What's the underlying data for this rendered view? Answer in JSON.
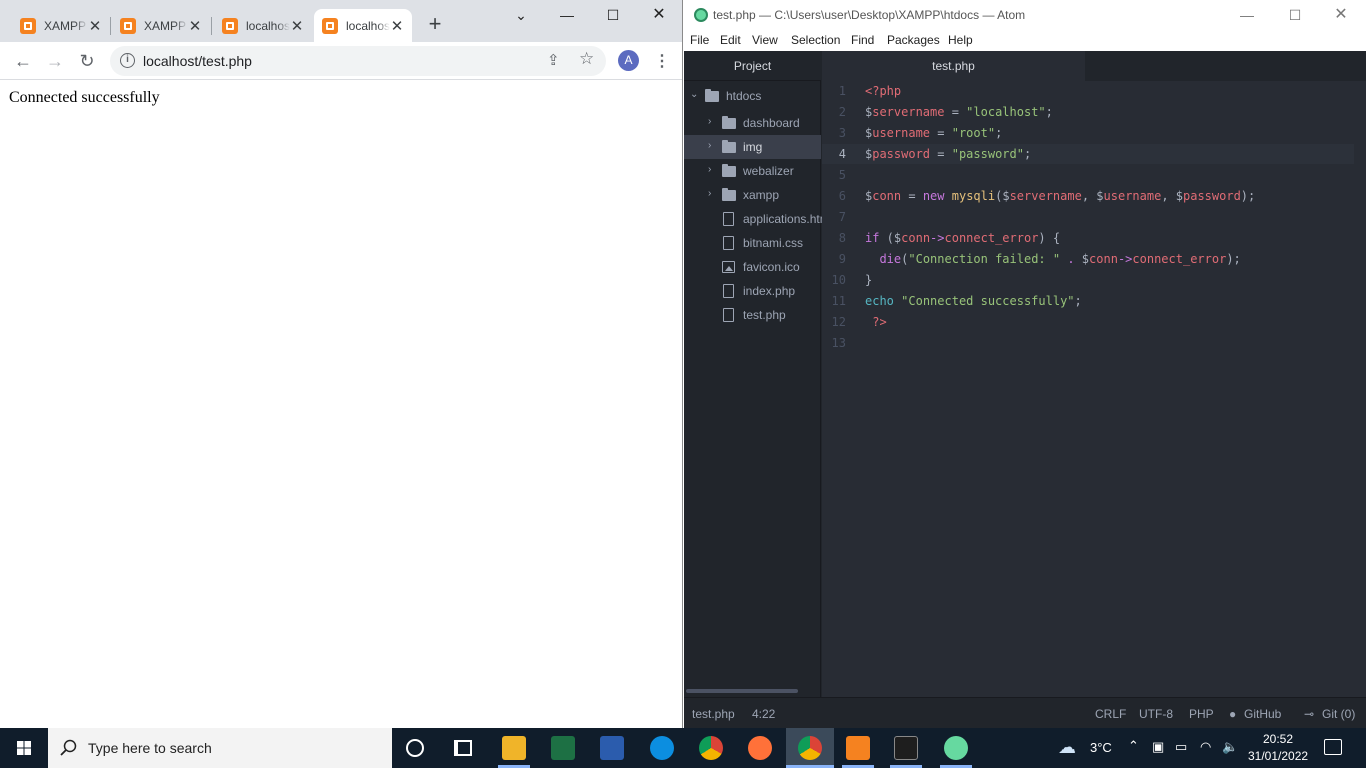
{
  "chrome": {
    "tabs": [
      {
        "title": "XAMPP",
        "active": false
      },
      {
        "title": "XAMPP",
        "active": false
      },
      {
        "title": "localhost",
        "active": false
      },
      {
        "title": "localhost",
        "active": true
      }
    ],
    "url": "localhost/test.php",
    "profile_initial": "A",
    "page_text": "Connected successfully"
  },
  "atom": {
    "window_title": "test.php — C:\\Users\\user\\Desktop\\XAMPP\\htdocs — Atom",
    "menu": [
      "File",
      "Edit",
      "View",
      "Selection",
      "Find",
      "Packages",
      "Help"
    ],
    "tree_header": "Project",
    "root_folder": "htdocs",
    "tree_items": [
      {
        "name": "dashboard",
        "type": "folder"
      },
      {
        "name": "img",
        "type": "folder",
        "selected": true
      },
      {
        "name": "webalizer",
        "type": "folder"
      },
      {
        "name": "xampp",
        "type": "folder"
      },
      {
        "name": "applications.html",
        "type": "file"
      },
      {
        "name": "bitnami.css",
        "type": "file"
      },
      {
        "name": "favicon.ico",
        "type": "image"
      },
      {
        "name": "index.php",
        "type": "file"
      },
      {
        "name": "test.php",
        "type": "file"
      }
    ],
    "editor_tab": "test.php",
    "current_line": 4,
    "line_numbers": [
      "1",
      "2",
      "3",
      "4",
      "5",
      "6",
      "7",
      "8",
      "9",
      "10",
      "11",
      "12",
      "13"
    ],
    "status": {
      "file": "test.php",
      "cursor": "4:22",
      "line_ending": "CRLF",
      "encoding": "UTF-8",
      "grammar": "PHP",
      "github": "GitHub",
      "git": "Git (0)"
    }
  },
  "taskbar": {
    "search_placeholder": "Type here to search",
    "weather": "3°C",
    "time": "20:52",
    "date": "31/01/2022"
  }
}
